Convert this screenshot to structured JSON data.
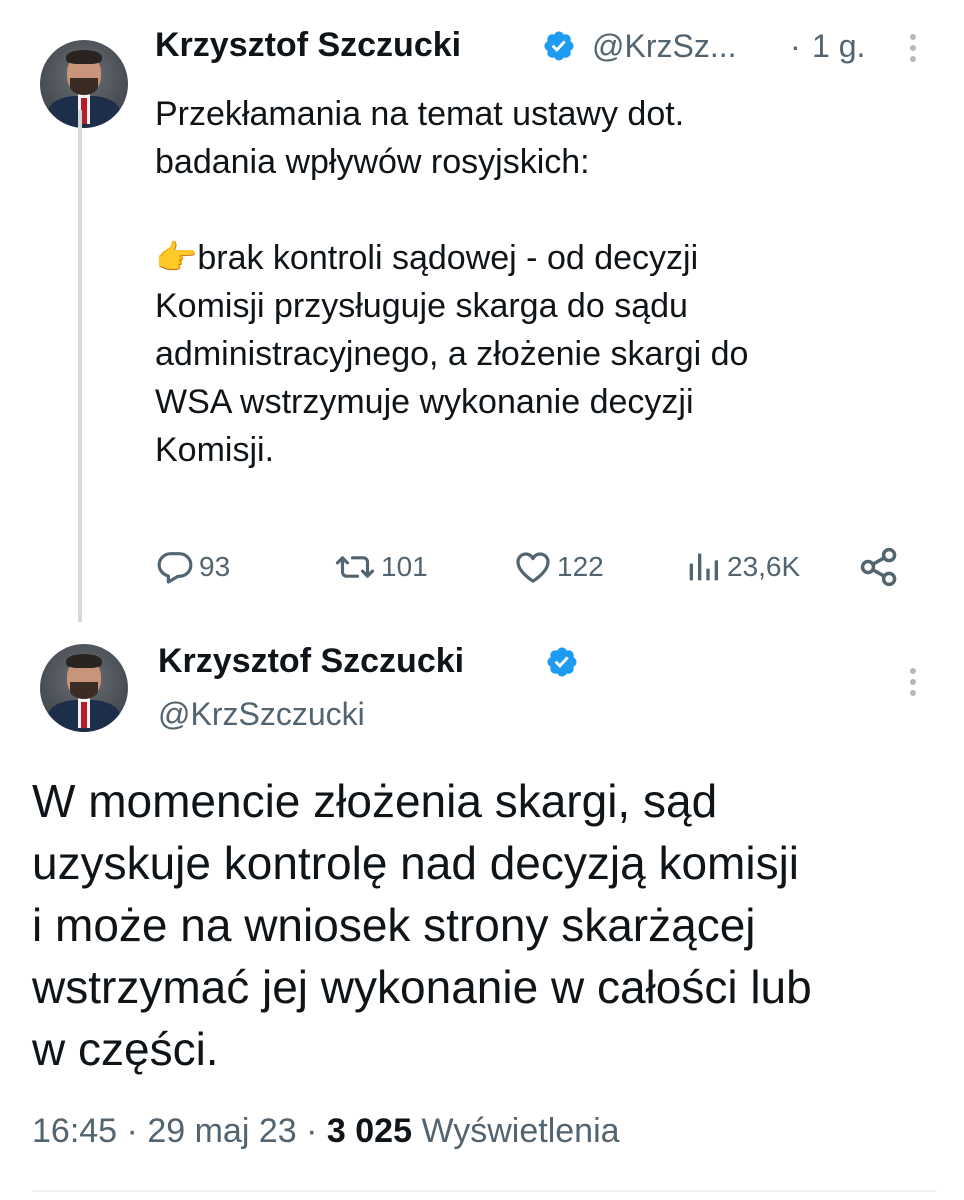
{
  "tweet1": {
    "author_name": "Krzysztof Szczucki",
    "author_handle": "@KrzSz...",
    "separator": "·",
    "time": "1 g.",
    "text_lines": [
      "Przekłamania na temat ustawy dot.",
      "badania wpływów rosyjskich:"
    ],
    "emoji": "👉",
    "body_lines": [
      "brak kontroli sądowej - od decyzji",
      "Komisji przysługuje skarga do sądu",
      "administracyjnego, a złożenie skargi do",
      "WSA wstrzymuje wykonanie decyzji",
      "Komisji."
    ],
    "stats": {
      "replies": "93",
      "retweets": "101",
      "likes": "122",
      "views": "23,6K"
    }
  },
  "tweet2": {
    "author_name": "Krzysztof Szczucki",
    "author_handle": "@KrzSzczucki",
    "text_lines": [
      "W momencie złożenia skargi, sąd",
      "uzyskuje kontrolę nad decyzją komisji",
      "i może na wniosek strony skarżącej",
      "wstrzymać jej wykonanie w całości lub",
      "w części."
    ],
    "time": "16:45",
    "sep1": "·",
    "date": "29 maj 23",
    "sep2": "·",
    "views_count": "3 025",
    "views_label": "Wyświetlenia"
  },
  "icons": {
    "verified": "verified-badge-icon",
    "more": "more-vertical-icon",
    "reply": "reply-icon",
    "retweet": "retweet-icon",
    "like": "heart-icon",
    "views": "views-chart-icon",
    "share": "share-icon"
  },
  "colors": {
    "verified_blue": "#1d9bf0",
    "text_primary": "#0f1419",
    "text_secondary": "#536471",
    "thread_line": "#cfd9de"
  }
}
